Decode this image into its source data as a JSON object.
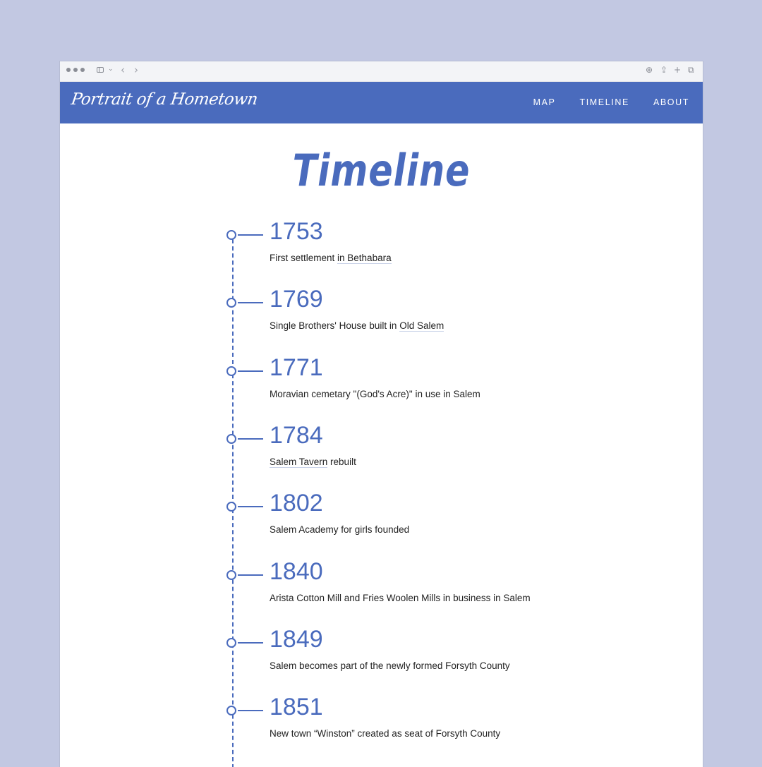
{
  "browser": {
    "toolbar_icons": [
      "sidebar-icon",
      "chevron-down-icon",
      "back-icon",
      "forward-icon",
      "download-icon",
      "share-icon",
      "new-tab-icon",
      "tabs-icon"
    ]
  },
  "header": {
    "logo_text": "Portrait of a Hometown",
    "nav": [
      "MAP",
      "TIMELINE",
      "ABOUT"
    ],
    "background": "#4a6bbd"
  },
  "page": {
    "title": "Timeline",
    "accent": "#4a6bbd"
  },
  "timeline": [
    {
      "year": "1753",
      "before": "First settlement ",
      "link": "in Bethabara",
      "after": ""
    },
    {
      "year": "1769",
      "before": "Single Brothers' House built in ",
      "link": "Old Salem",
      "after": ""
    },
    {
      "year": "1771",
      "before": "Moravian cemetary \"(God's Acre)\" in use in Salem",
      "link": "",
      "after": ""
    },
    {
      "year": "1784",
      "before": "",
      "link": "Salem Tavern",
      "after": " rebuilt"
    },
    {
      "year": "1802",
      "before": "Salem Academy for girls founded",
      "link": "",
      "after": ""
    },
    {
      "year": "1840",
      "before": "Arista Cotton Mill and Fries Woolen Mills in business in Salem",
      "link": "",
      "after": ""
    },
    {
      "year": "1849",
      "before": "Salem becomes part of the newly formed Forsyth County",
      "link": "",
      "after": ""
    },
    {
      "year": "1851",
      "before": "New town “Winston” created as seat of Forsyth County",
      "link": "",
      "after": ""
    }
  ]
}
